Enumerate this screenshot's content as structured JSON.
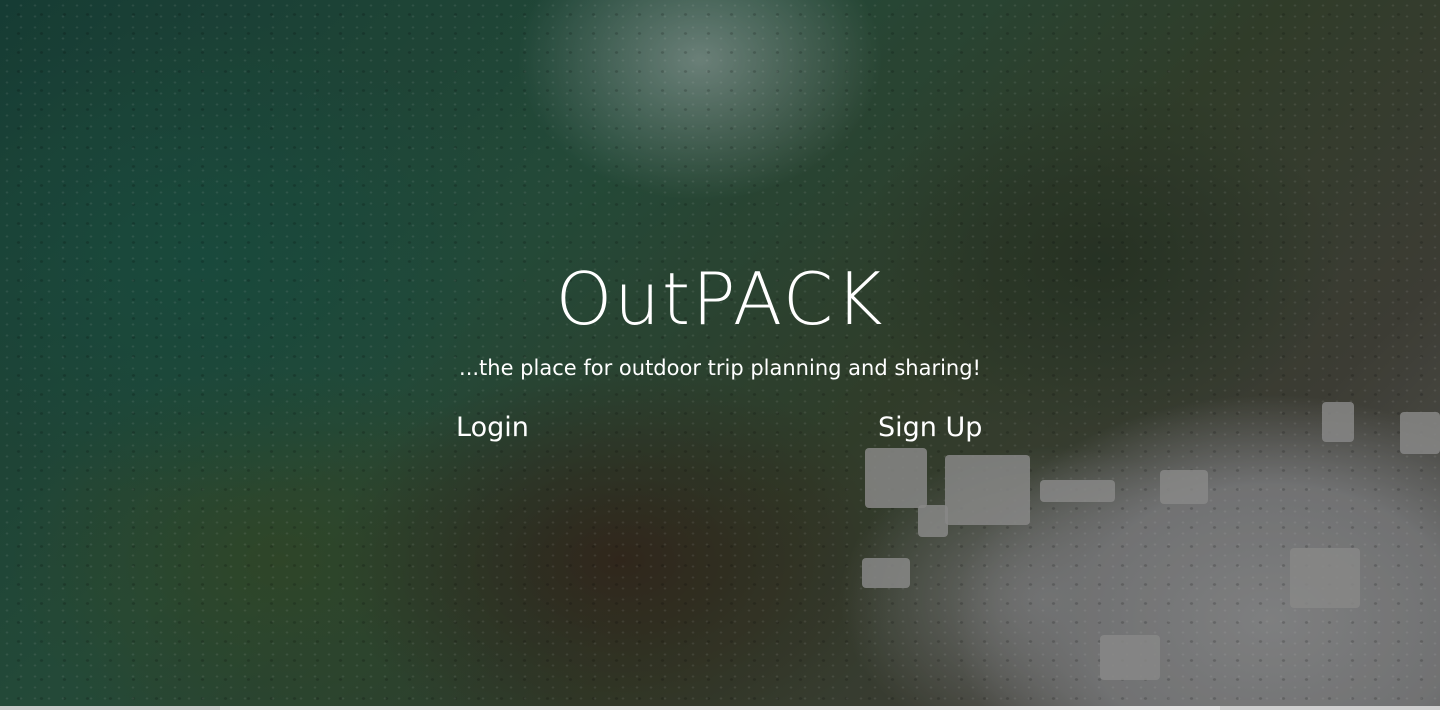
{
  "hero": {
    "title": "OutPACK",
    "tagline": "...the place for outdoor trip planning and sharing!"
  },
  "actions": {
    "login_label": "Login",
    "signup_label": "Sign Up"
  },
  "colors": {
    "text": "#ffffff",
    "water": "#1f5a4a",
    "shore_rocks": "#9a9b9c"
  }
}
